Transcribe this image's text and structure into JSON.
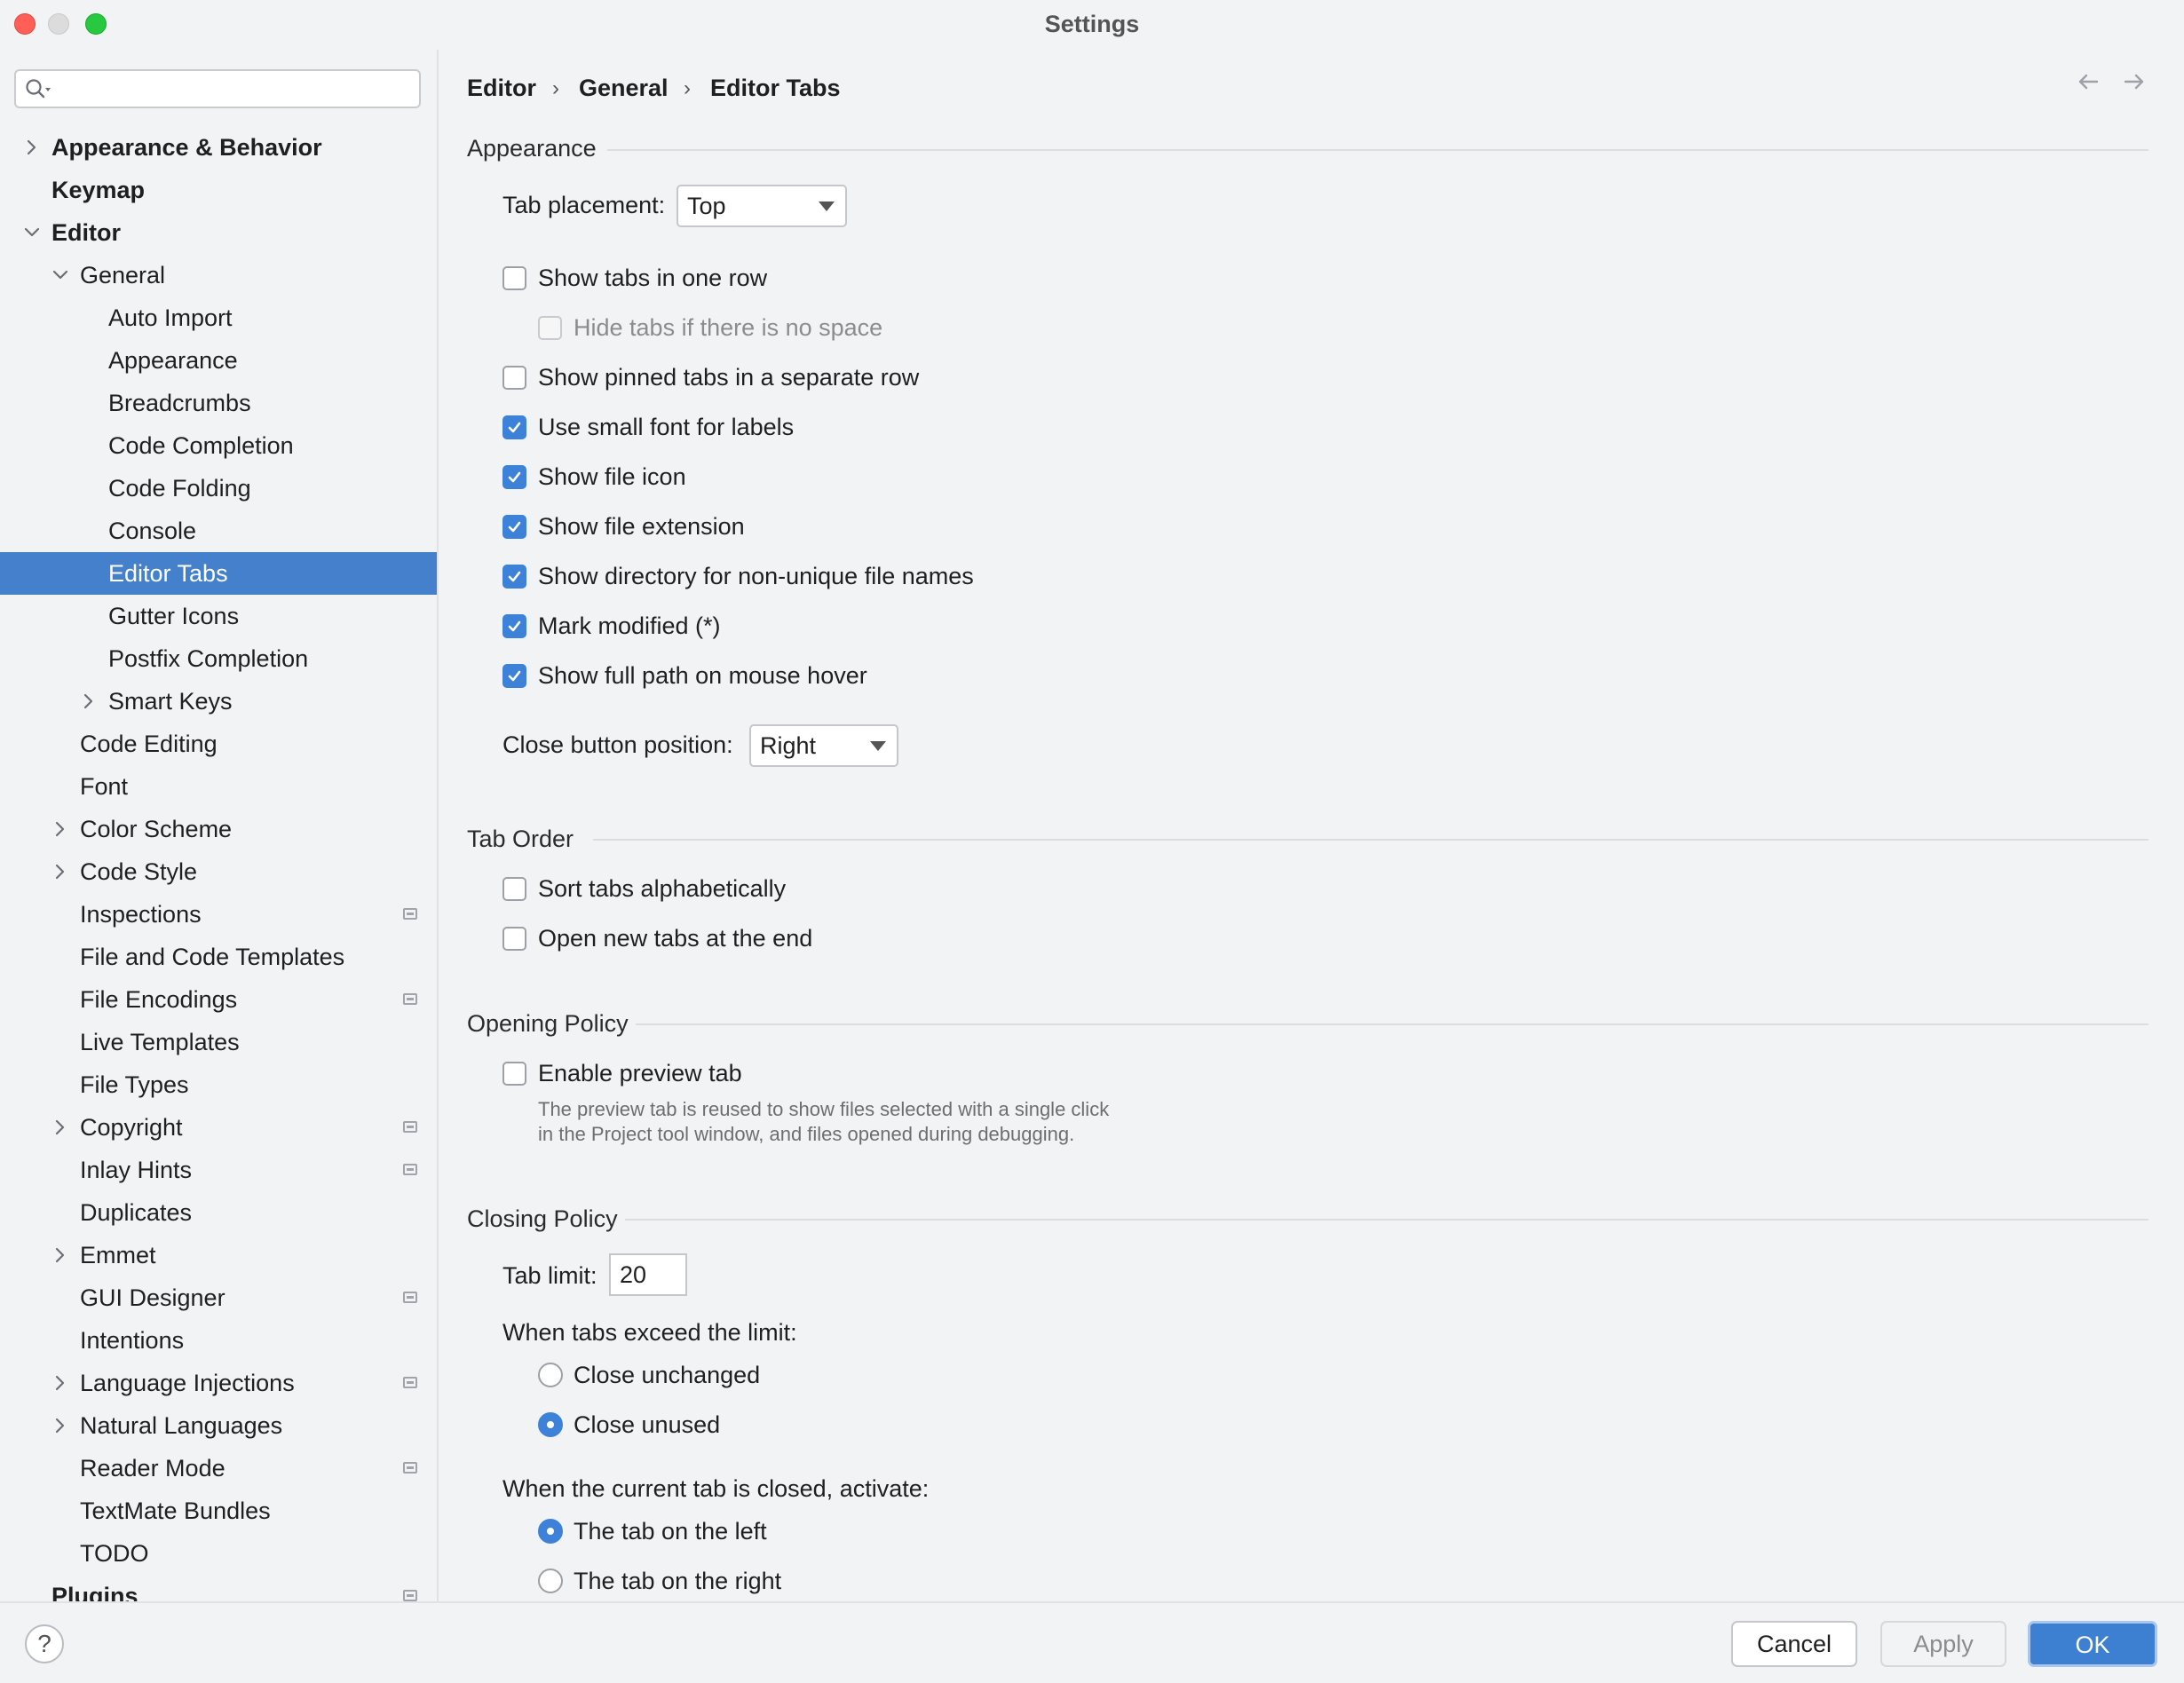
{
  "window": {
    "title": "Settings"
  },
  "search": {
    "placeholder": ""
  },
  "sidebar": {
    "items": [
      {
        "label": "Appearance & Behavior",
        "expander": "collapsed",
        "bold": true
      },
      {
        "label": "Keymap",
        "expander": "none",
        "bold": true
      },
      {
        "label": "Editor",
        "expander": "expanded",
        "bold": true
      },
      {
        "label": "General",
        "expander": "expanded"
      },
      {
        "label": "Auto Import",
        "expander": "none"
      },
      {
        "label": "Appearance",
        "expander": "none"
      },
      {
        "label": "Breadcrumbs",
        "expander": "none"
      },
      {
        "label": "Code Completion",
        "expander": "none"
      },
      {
        "label": "Code Folding",
        "expander": "none"
      },
      {
        "label": "Console",
        "expander": "none"
      },
      {
        "label": "Editor Tabs",
        "expander": "none",
        "selected": true
      },
      {
        "label": "Gutter Icons",
        "expander": "none"
      },
      {
        "label": "Postfix Completion",
        "expander": "none"
      },
      {
        "label": "Smart Keys",
        "expander": "collapsed"
      },
      {
        "label": "Code Editing",
        "expander": "none"
      },
      {
        "label": "Font",
        "expander": "none"
      },
      {
        "label": "Color Scheme",
        "expander": "collapsed"
      },
      {
        "label": "Code Style",
        "expander": "collapsed"
      },
      {
        "label": "Inspections",
        "expander": "none",
        "badge": "project-settings-icon"
      },
      {
        "label": "File and Code Templates",
        "expander": "none"
      },
      {
        "label": "File Encodings",
        "expander": "none",
        "badge": "project-settings-icon"
      },
      {
        "label": "Live Templates",
        "expander": "none"
      },
      {
        "label": "File Types",
        "expander": "none"
      },
      {
        "label": "Copyright",
        "expander": "collapsed",
        "badge": "project-settings-icon"
      },
      {
        "label": "Inlay Hints",
        "expander": "none",
        "badge": "project-settings-icon"
      },
      {
        "label": "Duplicates",
        "expander": "none"
      },
      {
        "label": "Emmet",
        "expander": "collapsed"
      },
      {
        "label": "GUI Designer",
        "expander": "none",
        "badge": "project-settings-icon"
      },
      {
        "label": "Intentions",
        "expander": "none"
      },
      {
        "label": "Language Injections",
        "expander": "collapsed",
        "badge": "project-settings-icon"
      },
      {
        "label": "Natural Languages",
        "expander": "collapsed"
      },
      {
        "label": "Reader Mode",
        "expander": "none",
        "badge": "project-settings-icon"
      },
      {
        "label": "TextMate Bundles",
        "expander": "none"
      },
      {
        "label": "TODO",
        "expander": "none"
      },
      {
        "label": "Plugins",
        "expander": "none",
        "bold": true,
        "badge": "project-settings-icon"
      }
    ]
  },
  "breadcrumb": [
    "Editor",
    "General",
    "Editor Tabs"
  ],
  "sections": {
    "appearance": {
      "title": "Appearance",
      "tab_placement_label": "Tab placement:",
      "tab_placement_value": "Top",
      "options": [
        {
          "label": "Show tabs in one row",
          "checked": false
        },
        {
          "label": "Hide tabs if there is no space",
          "checked": false,
          "disabled": true
        },
        {
          "label": "Show pinned tabs in a separate row",
          "checked": false
        },
        {
          "label": "Use small font for labels",
          "checked": true
        },
        {
          "label": "Show file icon",
          "checked": true
        },
        {
          "label": "Show file extension",
          "checked": true
        },
        {
          "label": "Show directory for non-unique file names",
          "checked": true
        },
        {
          "label": "Mark modified (*)",
          "checked": true
        },
        {
          "label": "Show full path on mouse hover",
          "checked": true
        }
      ],
      "close_button_label": "Close button position:",
      "close_button_value": "Right"
    },
    "tab_order": {
      "title": "Tab Order",
      "options": [
        {
          "label": "Sort tabs alphabetically",
          "checked": false
        },
        {
          "label": "Open new tabs at the end",
          "checked": false
        }
      ]
    },
    "opening_policy": {
      "title": "Opening Policy",
      "preview": {
        "label": "Enable preview tab",
        "checked": false
      },
      "hint_line1": "The preview tab is reused to show files selected with a single click",
      "hint_line2": "in the Project tool window, and files opened during debugging."
    },
    "closing_policy": {
      "title": "Closing Policy",
      "tab_limit_label": "Tab limit:",
      "tab_limit_value": "20",
      "exceed_label": "When tabs exceed the limit:",
      "exceed_options": [
        {
          "label": "Close unchanged",
          "selected": false
        },
        {
          "label": "Close unused",
          "selected": true
        }
      ],
      "activate_label": "When the current tab is closed, activate:",
      "activate_options": [
        {
          "label": "The tab on the left",
          "selected": true
        },
        {
          "label": "The tab on the right",
          "selected": false
        }
      ]
    }
  },
  "footer": {
    "help": "?",
    "cancel": "Cancel",
    "apply": "Apply",
    "ok": "OK"
  }
}
